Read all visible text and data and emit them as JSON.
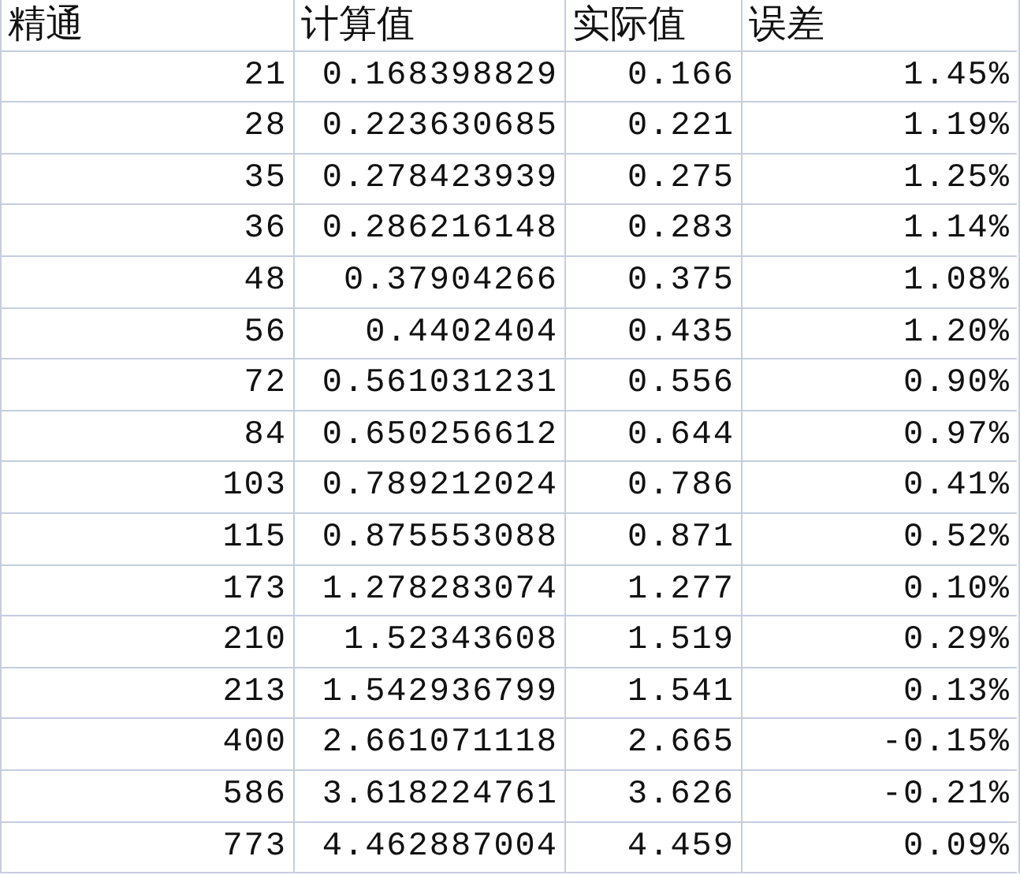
{
  "table": {
    "columns": [
      "精通",
      "计算值",
      "实际值",
      "误差"
    ],
    "rows": [
      [
        "21",
        "0.168398829",
        "0.166",
        "1.45%"
      ],
      [
        "28",
        "0.223630685",
        "0.221",
        "1.19%"
      ],
      [
        "35",
        "0.278423939",
        "0.275",
        "1.25%"
      ],
      [
        "36",
        "0.286216148",
        "0.283",
        "1.14%"
      ],
      [
        "48",
        "0.37904266",
        "0.375",
        "1.08%"
      ],
      [
        "56",
        "0.4402404",
        "0.435",
        "1.20%"
      ],
      [
        "72",
        "0.561031231",
        "0.556",
        "0.90%"
      ],
      [
        "84",
        "0.650256612",
        "0.644",
        "0.97%"
      ],
      [
        "103",
        "0.789212024",
        "0.786",
        "0.41%"
      ],
      [
        "115",
        "0.875553088",
        "0.871",
        "0.52%"
      ],
      [
        "173",
        "1.278283074",
        "1.277",
        "0.10%"
      ],
      [
        "210",
        "1.52343608",
        "1.519",
        "0.29%"
      ],
      [
        "213",
        "1.542936799",
        "1.541",
        "0.13%"
      ],
      [
        "400",
        "2.661071118",
        "2.665",
        "-0.15%"
      ],
      [
        "586",
        "3.618224761",
        "3.626",
        "-0.21%"
      ],
      [
        "773",
        "4.462887004",
        "4.459",
        "0.09%"
      ]
    ]
  }
}
